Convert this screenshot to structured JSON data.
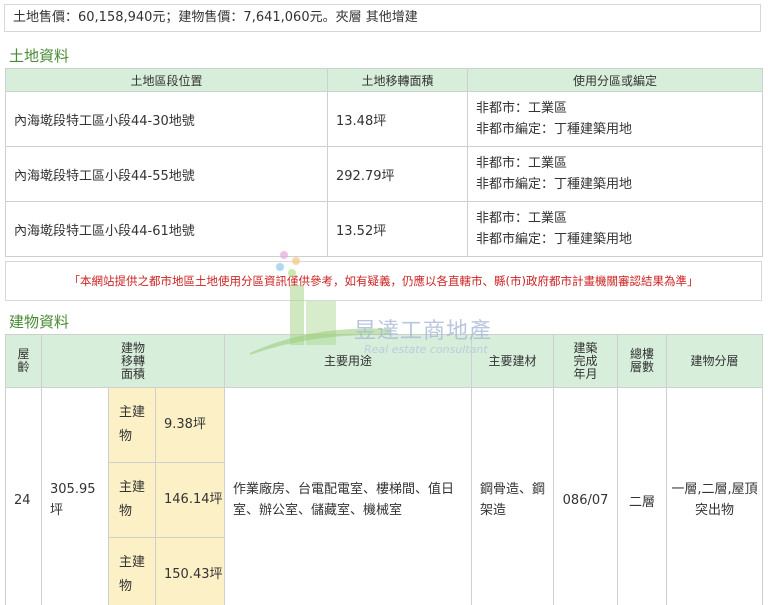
{
  "summary": "土地售價：60,158,940元；建物售價：7,641,060元。夾層 其他增建",
  "land": {
    "title": "土地資料",
    "headers": [
      "土地區段位置",
      "土地移轉面積",
      "使用分區或編定"
    ],
    "rows": [
      {
        "location": "內海墘段特工區小段44-30地號",
        "area": "13.48坪",
        "zone": "非都市：工業區",
        "zone_code": "非都市編定：丁種建築用地"
      },
      {
        "location": "內海墘段特工區小段44-55地號",
        "area": "292.79坪",
        "zone": "非都市：工業區",
        "zone_code": "非都市編定：丁種建築用地"
      },
      {
        "location": "內海墘段特工區小段44-61地號",
        "area": "13.52坪",
        "zone": "非都市：工業區",
        "zone_code": "非都市編定：丁種建築用地"
      }
    ]
  },
  "notice": "「本網站提供之都市地區土地使用分區資訊僅供參考，如有疑義，仍應以各直轄市、縣(市)政府都市計畫機關審認結果為準」",
  "building": {
    "title": "建物資料",
    "headers": {
      "age": "屋齡",
      "area": "建物移轉面積",
      "usage": "主要用途",
      "material": "主要建材",
      "built": "建築完成年月",
      "floors": "總樓層數",
      "layer": "建物分層"
    },
    "row": {
      "age": "24",
      "total_area": "305.95坪",
      "sub_label": "主建物",
      "sub_areas": [
        "9.38坪",
        "146.14坪",
        "150.43坪"
      ],
      "usage": "作業廠房、台電配電室、樓梯間、值日室、辦公室、儲藏室、機械室",
      "material": "鋼骨造、鋼架造",
      "built": "086/07",
      "floors": "二層",
      "layer": "一層,二層,屋頂突出物"
    }
  },
  "watermark": {
    "name": "昱達工商地產",
    "tagline": "Real estate consultant"
  }
}
